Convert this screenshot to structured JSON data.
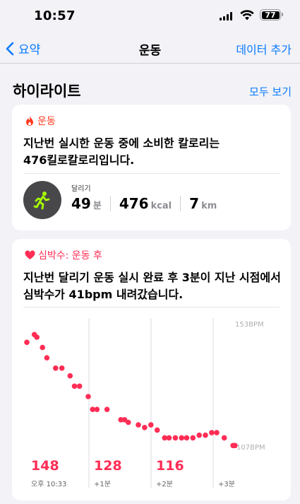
{
  "status": {
    "time": "10:57",
    "battery": "77"
  },
  "nav": {
    "back": "요약",
    "title": "운동",
    "action": "데이터 추가"
  },
  "section": {
    "title": "하이라이트",
    "more": "모두 보기"
  },
  "workout_card": {
    "label": "운동",
    "text_line1": "지난번 실시한 운동 중에 소비한 칼로리는",
    "text_line2": "476킬로칼로리입니다.",
    "activity": "달리기",
    "stats": [
      {
        "value": "49",
        "unit": "분"
      },
      {
        "value": "476",
        "unit": "kcal"
      },
      {
        "value": "7",
        "unit": "km"
      }
    ]
  },
  "heart_card": {
    "label": "심박수: 운동 후",
    "text_line1": "지난번 달리기 운동 실시 완료 후 3분이 지난 시점에서",
    "text_line2": "심박수가 41bpm 내려갔습니다.",
    "ymax_label": "153BPM",
    "ymin_label": "107BPM",
    "readings": [
      {
        "value": "148",
        "label": "오후 10:33"
      },
      {
        "value": "128",
        "label": "+1분"
      },
      {
        "value": "116",
        "label": "+2분"
      },
      {
        "value": "",
        "label": "+3분"
      }
    ]
  },
  "chart_data": {
    "type": "scatter",
    "xlabel": "",
    "ylabel": "",
    "xlim": [
      0,
      3.3
    ],
    "ylim": [
      107,
      153
    ],
    "x": [
      0,
      0.12,
      0.16,
      0.25,
      0.32,
      0.46,
      0.56,
      0.69,
      0.76,
      0.84,
      0.98,
      1.05,
      1.12,
      1.28,
      1.5,
      1.56,
      1.62,
      1.78,
      1.88,
      1.98,
      2.08,
      2.2,
      2.27,
      2.37,
      2.47,
      2.55,
      2.65,
      2.75,
      2.85,
      2.95,
      3.03,
      3.15,
      3.29,
      3.43
    ],
    "y": [
      148,
      151,
      150,
      146,
      142,
      138,
      138,
      135,
      131,
      131,
      127,
      122,
      122,
      122,
      118,
      118,
      117,
      116,
      115,
      116,
      114,
      111,
      111,
      111,
      111,
      111,
      111,
      112,
      112,
      113,
      113,
      111,
      108,
      108
    ],
    "color": "#ff2d55"
  },
  "colors": {
    "accent": "#0a7aff",
    "workout": "#ff3b1f",
    "heart": "#ff2d55",
    "run_icon": "#a6ff00"
  }
}
